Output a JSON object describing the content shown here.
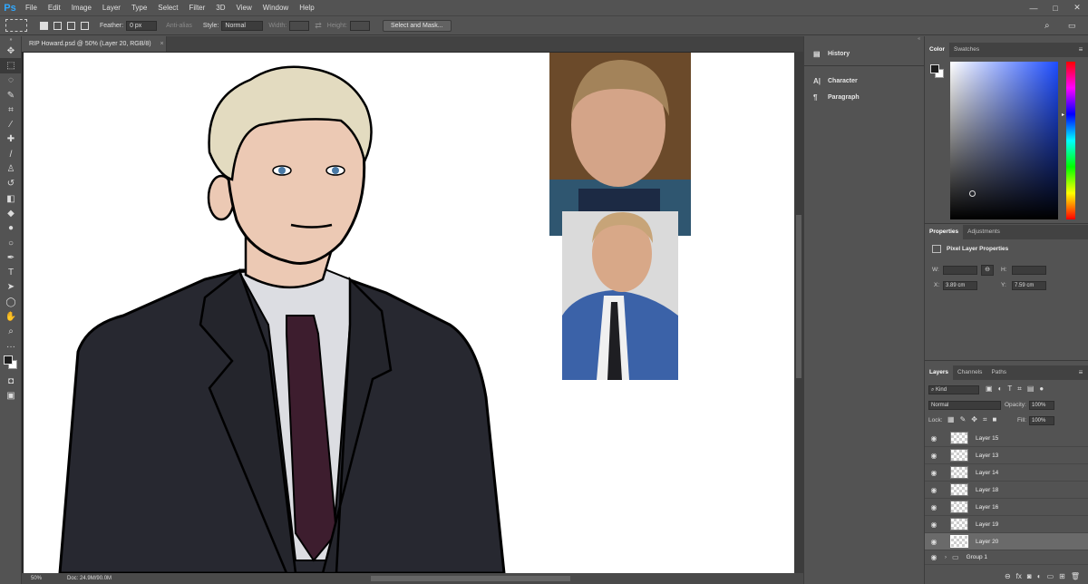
{
  "app": {
    "logo": "Ps"
  },
  "menu": [
    "File",
    "Edit",
    "Image",
    "Layer",
    "Type",
    "Select",
    "Filter",
    "3D",
    "View",
    "Window",
    "Help"
  ],
  "window_controls": {
    "minimize": "—",
    "maximize": "□",
    "close": "✕"
  },
  "options": {
    "feather_label": "Feather:",
    "feather_value": "0 px",
    "antialias_label": "Anti-alias",
    "style_label": "Style:",
    "style_value": "Normal",
    "width_label": "Width:",
    "height_label": "Height:",
    "select_mask_label": "Select and Mask..."
  },
  "document": {
    "tab_title": "RIP Howard.psd @ 50% (Layer 20, RGB/8)"
  },
  "status": {
    "zoom": "50%",
    "doc_info": "Doc: 24.9M/90.0M"
  },
  "collapsed_panels": [
    "History",
    "Character",
    "Paragraph"
  ],
  "color_panel": {
    "tabs": [
      "Color",
      "Swatches"
    ],
    "fg": "#1d1d1d",
    "bg": "#ffffff",
    "hue": "#1e4dff"
  },
  "properties_panel": {
    "tabs": [
      "Properties",
      "Adjustments"
    ],
    "title": "Pixel Layer Properties",
    "w_label": "W:",
    "h_label": "H:",
    "x_label": "X:",
    "x_value": "3.89 cm",
    "y_label": "Y:",
    "y_value": "7.59 cm"
  },
  "layers_panel": {
    "tabs": [
      "Layers",
      "Channels",
      "Paths"
    ],
    "filter_label": "Kind",
    "blend_mode": "Normal",
    "opacity_label": "Opacity:",
    "opacity_value": "100%",
    "lock_label": "Lock:",
    "fill_label": "Fill:",
    "fill_value": "100%",
    "layers": [
      "Layer 15",
      "Layer 13",
      "Layer 14",
      "Layer 18",
      "Layer 16",
      "Layer 19",
      "Layer 20"
    ],
    "selected": "Layer 20",
    "group": "Group 1"
  }
}
